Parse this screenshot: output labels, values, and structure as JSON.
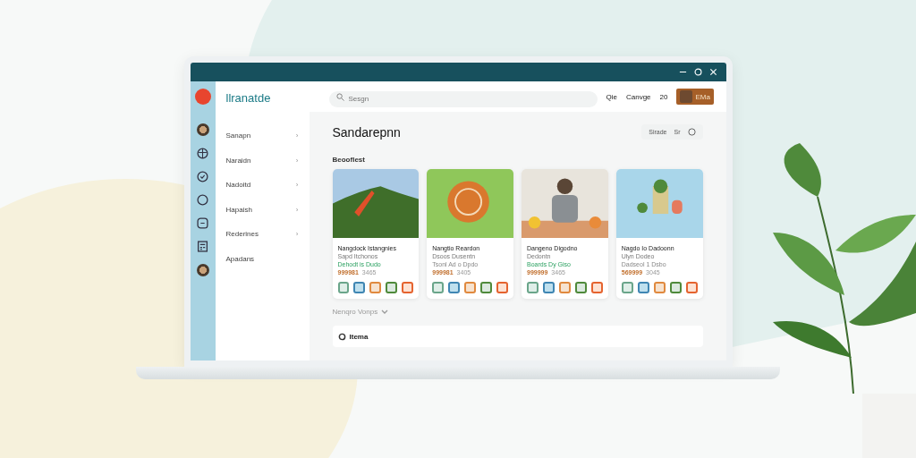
{
  "app": {
    "logo_text": "llranatde"
  },
  "search": {
    "placeholder": "Sesgn"
  },
  "header_links": [
    "Qie",
    "Canvge",
    "20"
  ],
  "profile": {
    "label": "EMa"
  },
  "sidebar": {
    "items": [
      {
        "label": "Sanapn",
        "arrow": "›"
      },
      {
        "label": "Naraidn",
        "arrow": "›"
      },
      {
        "label": "Nadoitd",
        "arrow": "›"
      },
      {
        "label": "Hapaish",
        "arrow": "›"
      },
      {
        "label": "Rederines",
        "arrow": "›"
      },
      {
        "label": "Apadans"
      }
    ]
  },
  "page": {
    "title": "Sandarepnn",
    "actions": [
      "Sirade",
      "Sr"
    ]
  },
  "section": {
    "title": "Beooflest"
  },
  "cards": [
    {
      "title": "Nangdock Istangnies",
      "subtitle": "Sapd Itchonos",
      "tag": "Dehodt is Dudo",
      "tag_green": true,
      "rating": "999981",
      "count": "3465"
    },
    {
      "title": "Nangtio Reardon",
      "subtitle": "Dsoos Dusentn",
      "tag": "Tsonl Ad o Dpdo",
      "tag_green": false,
      "rating": "999981",
      "count": "3405"
    },
    {
      "title": "Dangeno Digodno",
      "subtitle": "Dedontn",
      "tag": "Boards Dy Giso",
      "tag_green": true,
      "rating": "999999",
      "count": "3465"
    },
    {
      "title": "Nagdo Io Dadoonn",
      "subtitle": "Ulyn Dodeo",
      "tag": "Dadseol 1 Dsbo",
      "tag_green": false,
      "rating": "569999",
      "count": "3045"
    }
  ],
  "more": {
    "label": "Nenqro Vonps"
  },
  "panel": {
    "title": "Itema"
  }
}
